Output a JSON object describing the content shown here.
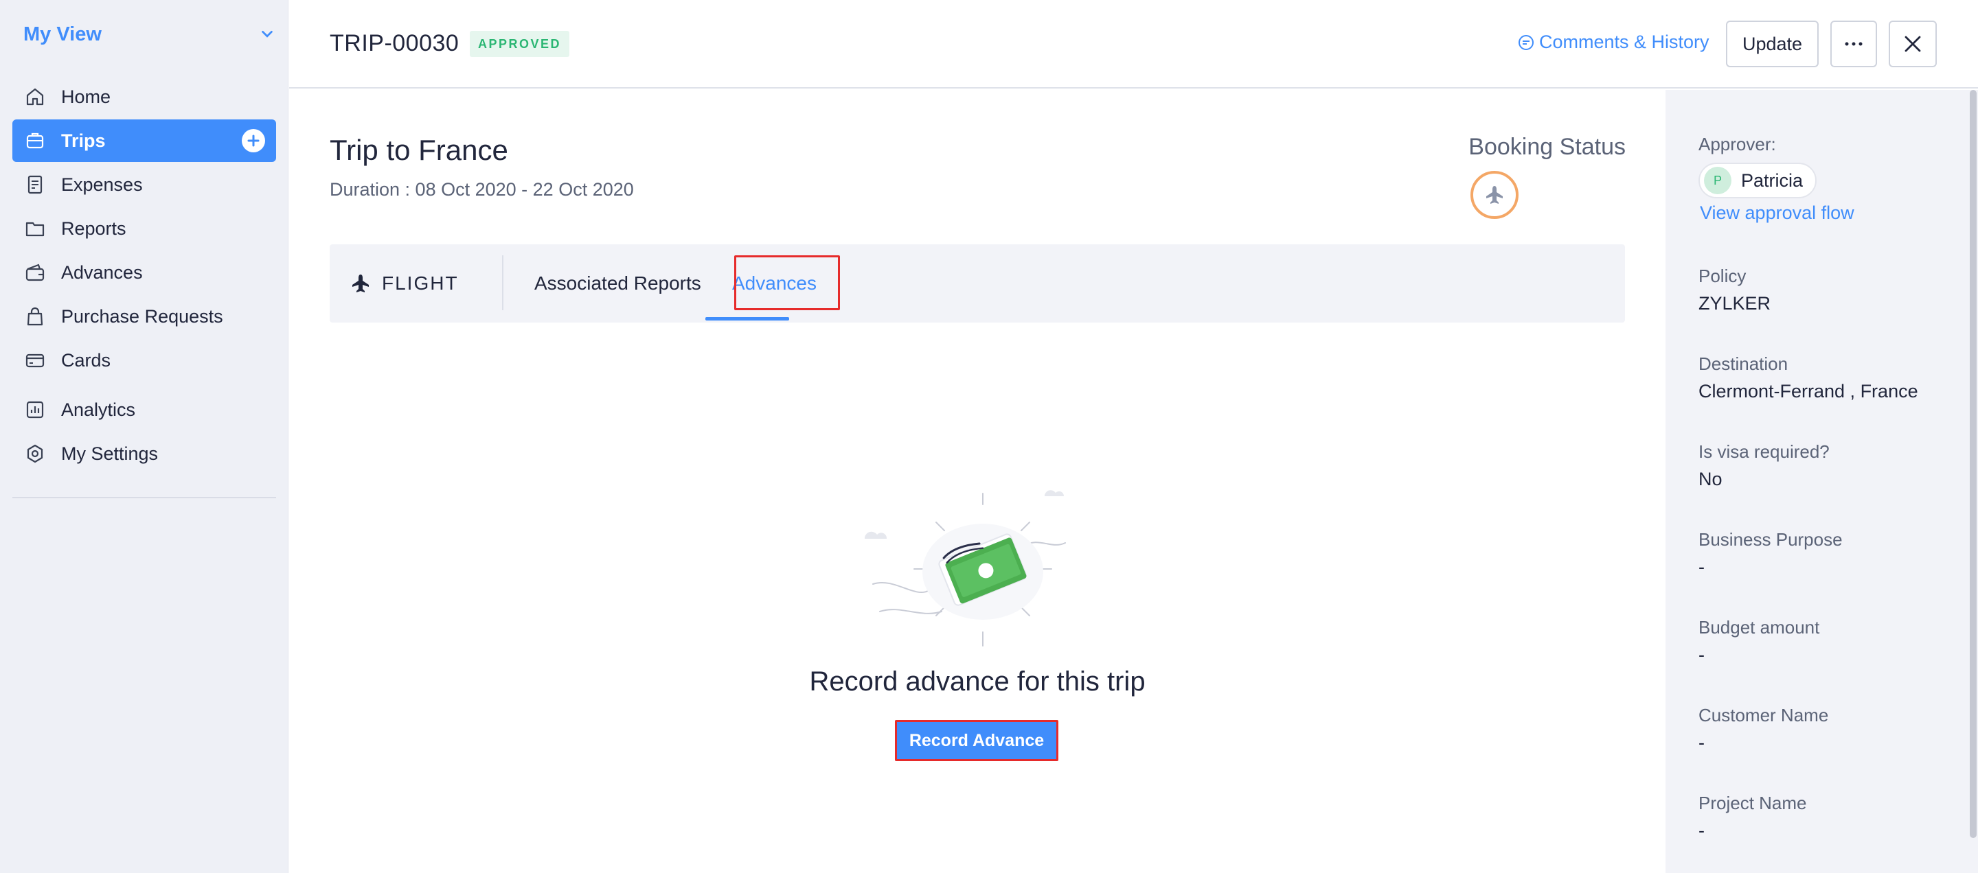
{
  "sidebar": {
    "title": "My View",
    "items": [
      {
        "label": "Home",
        "icon": "home-icon"
      },
      {
        "label": "Trips",
        "icon": "trips-icon",
        "active": true
      },
      {
        "label": "Expenses",
        "icon": "receipt-icon"
      },
      {
        "label": "Reports",
        "icon": "folder-icon"
      },
      {
        "label": "Advances",
        "icon": "wallet-icon"
      },
      {
        "label": "Purchase Requests",
        "icon": "bag-icon"
      },
      {
        "label": "Cards",
        "icon": "card-icon"
      },
      {
        "label": "Analytics",
        "icon": "chart-icon"
      },
      {
        "label": "My Settings",
        "icon": "gear-icon"
      }
    ]
  },
  "header": {
    "trip_id": "TRIP-00030",
    "status_badge": "APPROVED",
    "comments_link": "Comments & History",
    "update_label": "Update",
    "more_label": "···"
  },
  "main": {
    "trip_name": "Trip to France",
    "duration": "Duration : 08 Oct 2020 - 22 Oct 2020",
    "booking_status_label": "Booking Status",
    "tabs": {
      "flight": "FLIGHT",
      "associated_reports": "Associated Reports",
      "advances": "Advances"
    },
    "empty_message": "Record advance for this trip",
    "record_button": "Record Advance"
  },
  "details": {
    "approver_label": "Approver:",
    "approver_initial": "P",
    "approver_name": "Patricia",
    "approval_flow_link": "View approval flow",
    "policy_label": "Policy",
    "policy_value": "ZYLKER",
    "destination_label": "Destination",
    "destination_value": "Clermont-Ferrand , France",
    "visa_label": "Is visa required?",
    "visa_value": "No",
    "purpose_label": "Business Purpose",
    "purpose_value": "-",
    "budget_label": "Budget amount",
    "budget_value": "-",
    "customer_label": "Customer Name",
    "customer_value": "-",
    "project_label": "Project Name",
    "project_value": "-"
  },
  "colors": {
    "accent": "#408dfb",
    "approved": "#2bb673",
    "highlight": "#e62b2b",
    "booking_ring": "#f4a766"
  }
}
